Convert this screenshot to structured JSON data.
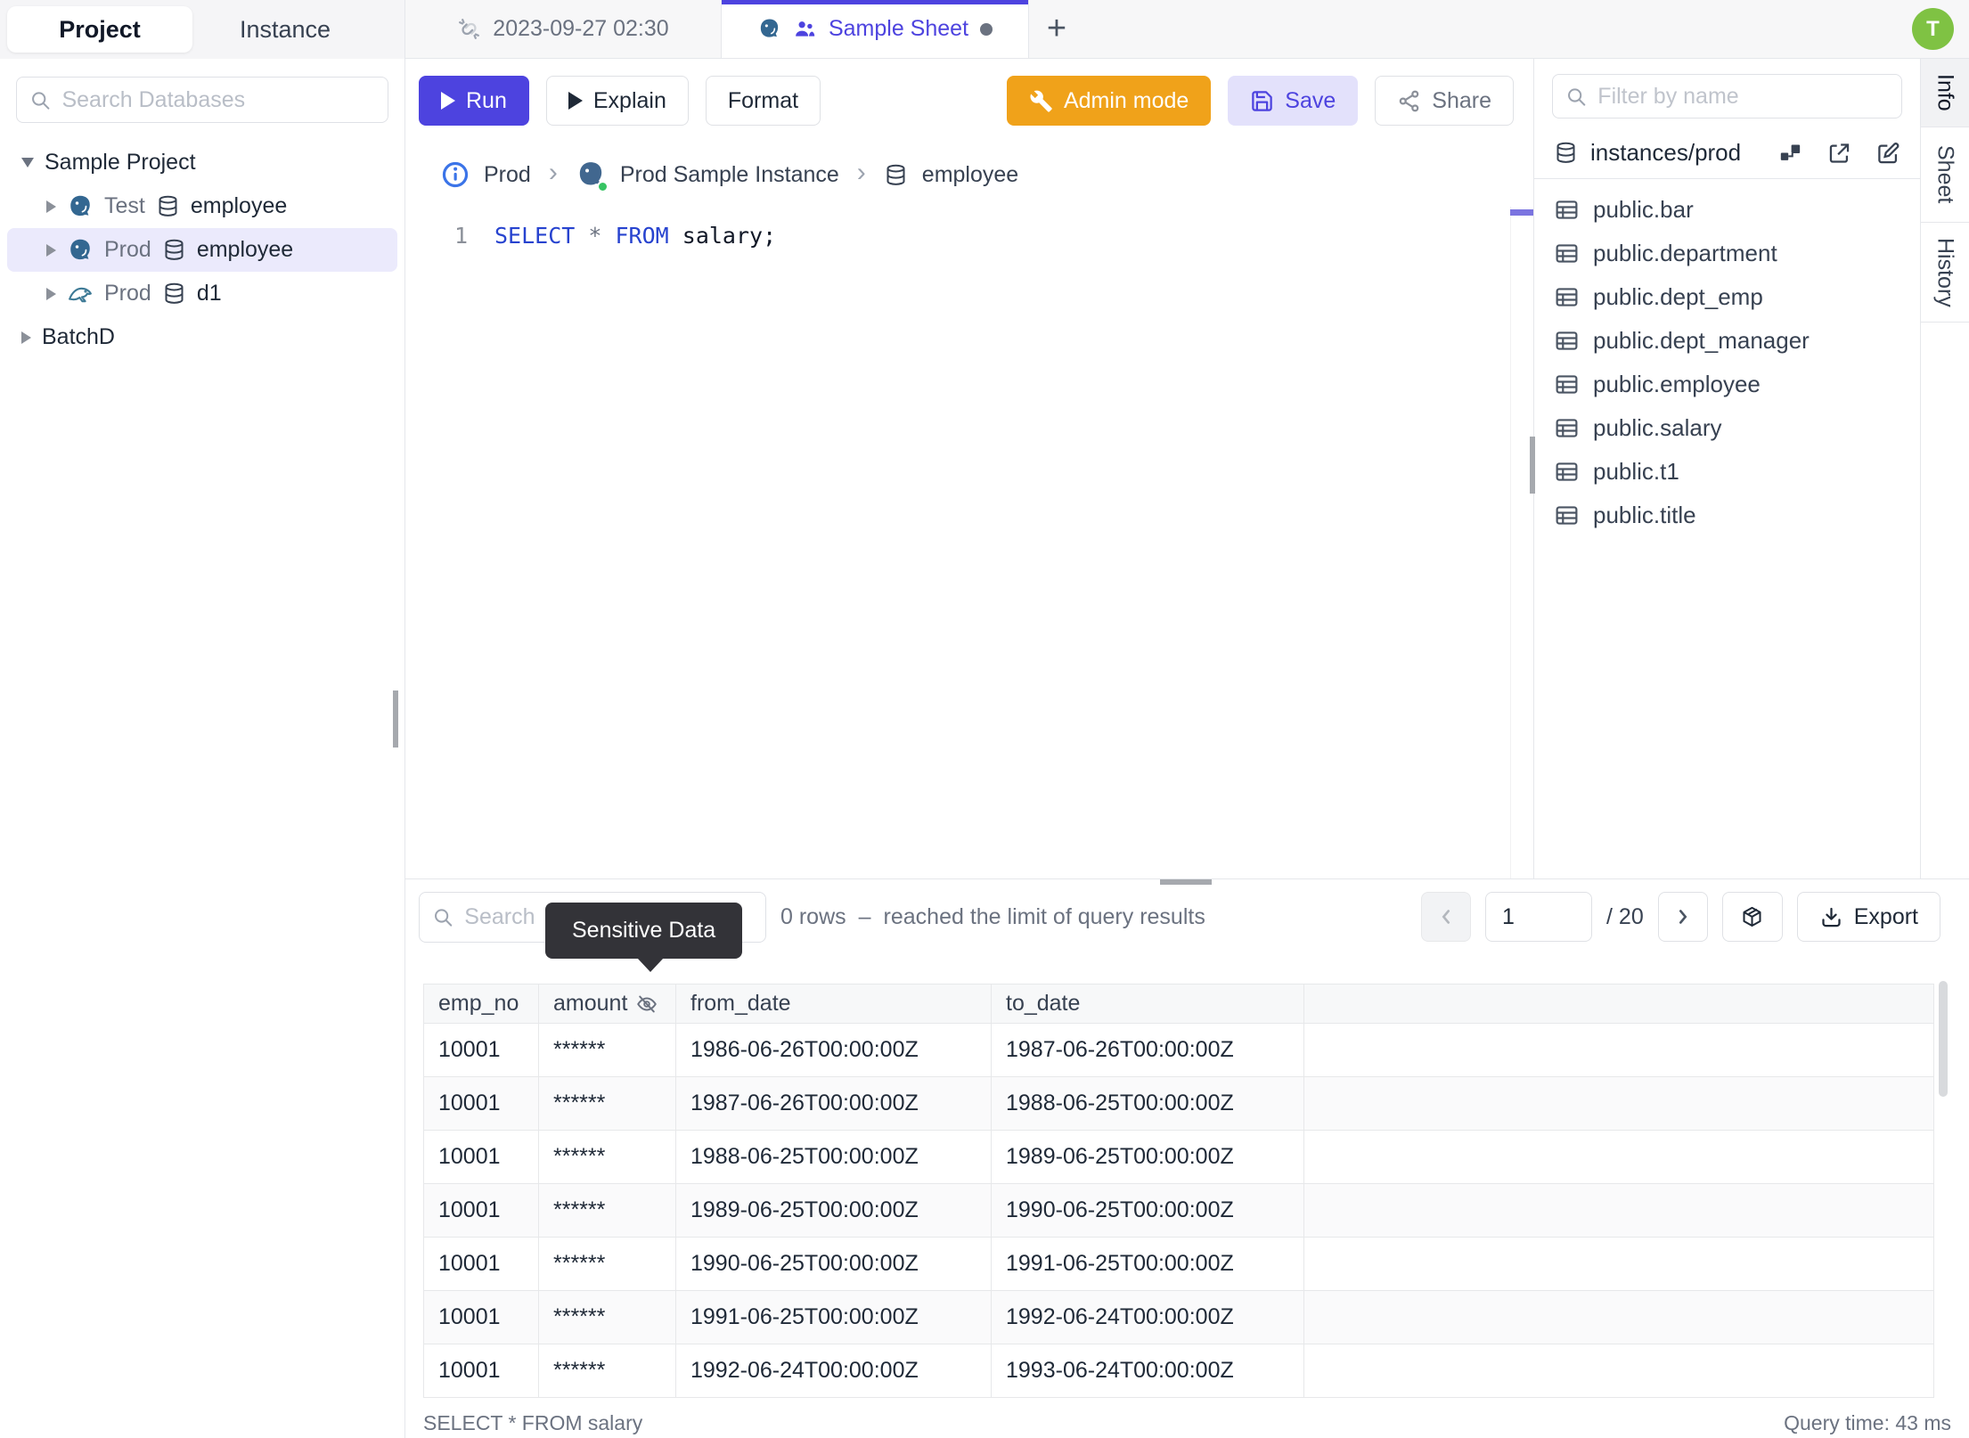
{
  "colors": {
    "accent": "#4d43df",
    "admin_orange": "#f0a21a",
    "avatar_green": "#7fc243",
    "selected_item": "#ebeafc",
    "tooltip_bg": "#333338",
    "status_green": "#37c463"
  },
  "left_sidebar": {
    "tabs": [
      {
        "label": "Project",
        "active": true
      },
      {
        "label": "Instance",
        "active": false
      }
    ],
    "search_placeholder": "Search Databases",
    "tree": [
      {
        "type": "project",
        "caret": "down",
        "label": "Sample Project",
        "selected": false
      },
      {
        "type": "database",
        "caret": "right",
        "engine": "postgres",
        "env": "Test",
        "db": "employee",
        "selected": false
      },
      {
        "type": "database",
        "caret": "right",
        "engine": "postgres",
        "env": "Prod",
        "db": "employee",
        "selected": true
      },
      {
        "type": "database",
        "caret": "right",
        "engine": "mysql",
        "env": "Prod",
        "db": "d1",
        "selected": false
      },
      {
        "type": "project",
        "caret": "right",
        "label": "BatchD",
        "selected": false
      }
    ]
  },
  "topbar": {
    "tabs": [
      {
        "label": "2023-09-27 02:30",
        "icon": "unlink",
        "active": false
      },
      {
        "label": "Sample Sheet",
        "icons": [
          "postgresql",
          "people"
        ],
        "active": true,
        "dirty": true
      }
    ],
    "new_tab_label": "+",
    "avatar_text": "T"
  },
  "toolbar": {
    "run_label": "Run",
    "explain_label": "Explain",
    "format_label": "Format",
    "admin_mode_label": "Admin mode",
    "save_label": "Save",
    "share_label": "Share"
  },
  "breadcrumb": {
    "env": "Prod",
    "separator": "›",
    "instance": "Prod Sample Instance",
    "database": "employee"
  },
  "editor": {
    "line_number": "1",
    "sql": {
      "kw1": "SELECT",
      "star": "*",
      "kw2": "FROM",
      "rest": "salary;"
    }
  },
  "right_sidebar": {
    "filter_placeholder": "Filter by name",
    "instance_path": "instances/prod",
    "tables": [
      "public.bar",
      "public.department",
      "public.dept_emp",
      "public.dept_manager",
      "public.employee",
      "public.salary",
      "public.t1",
      "public.title"
    ]
  },
  "right_tabs": [
    "Info",
    "Sheet",
    "History"
  ],
  "results": {
    "search_placeholder": "Search",
    "tooltip": "Sensitive Data",
    "row_summary": "0 rows",
    "summary_sep": "–",
    "summary_rest": "reached the limit of query results",
    "page_value": "1",
    "page_total": "/ 20",
    "export_label": "Export",
    "columns": [
      "emp_no",
      "amount",
      "from_date",
      "to_date"
    ],
    "masked_column": "amount",
    "rows": [
      [
        "10001",
        "******",
        "1986-06-26T00:00:00Z",
        "1987-06-26T00:00:00Z"
      ],
      [
        "10001",
        "******",
        "1987-06-26T00:00:00Z",
        "1988-06-25T00:00:00Z"
      ],
      [
        "10001",
        "******",
        "1988-06-25T00:00:00Z",
        "1989-06-25T00:00:00Z"
      ],
      [
        "10001",
        "******",
        "1989-06-25T00:00:00Z",
        "1990-06-25T00:00:00Z"
      ],
      [
        "10001",
        "******",
        "1990-06-25T00:00:00Z",
        "1991-06-25T00:00:00Z"
      ],
      [
        "10001",
        "******",
        "1991-06-25T00:00:00Z",
        "1992-06-24T00:00:00Z"
      ],
      [
        "10001",
        "******",
        "1992-06-24T00:00:00Z",
        "1993-06-24T00:00:00Z"
      ]
    ]
  },
  "statusbar": {
    "query": "SELECT * FROM salary",
    "query_time": "Query time: 43 ms"
  }
}
